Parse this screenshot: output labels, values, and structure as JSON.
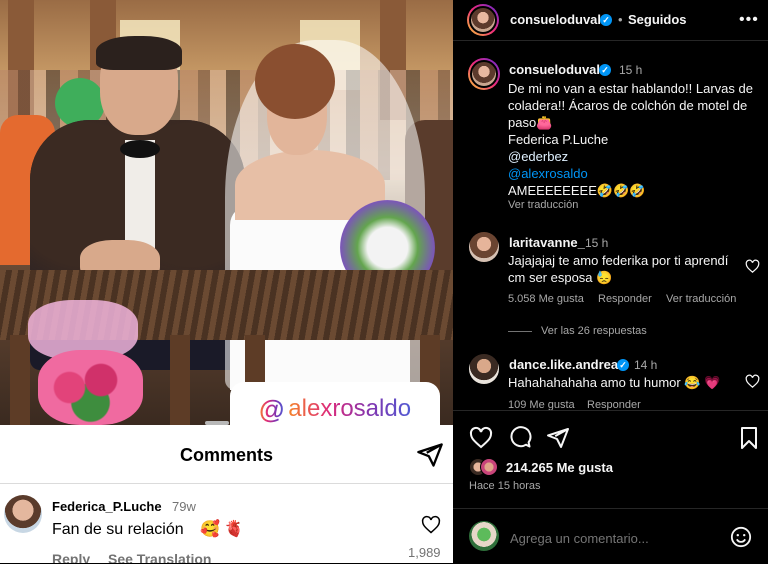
{
  "image_overlay": {
    "threads_handle": "alexrosaldo",
    "comments_panel": {
      "title": "Comments",
      "comment": {
        "user": "Federica_P.Luche",
        "time": "79w",
        "text": "Fan de su relación",
        "emoji": "🥰 🫀",
        "likes": "1,989",
        "reply_label": "Reply",
        "see_translation_label": "See Translation"
      }
    }
  },
  "header": {
    "username": "consueloduval",
    "dot": "•",
    "follow_status": "Seguidos",
    "more_label": "•••"
  },
  "caption": {
    "username": "consueloduval",
    "time": "15 h",
    "line1": "De mi no van a estar hablando!! Larvas de",
    "line2": "coladera!! Ácaros de colchón de motel de",
    "line3": "paso👛",
    "line4": "Federica P.Luche",
    "line5": "@ederbez",
    "line6": "@alexrosaldo",
    "line7": "AMEEEEEEEE🤣🤣🤣",
    "see_translation": "Ver traducción"
  },
  "comments": [
    {
      "username": "laritavanne_",
      "time": "15 h",
      "line1": "Jajajajaj te amo federika por ti aprendí",
      "line2": "cm ser esposa 😓",
      "likes": "5.058 Me gusta",
      "reply_label": "Responder",
      "see_translation": "Ver traducción",
      "view_replies": "Ver las 26 respuestas"
    },
    {
      "username": "dance.like.andrea",
      "time": "14 h",
      "text": "Hahahahahaha amo tu humor 😂 💗",
      "likes": "109 Me gusta",
      "reply_label": "Responder"
    }
  ],
  "actions": {
    "likes": "214.265 Me gusta",
    "posted": "Hace 15 horas"
  },
  "add_comment": {
    "placeholder": "Agrega un comentario..."
  },
  "colors": {
    "background": "#000000",
    "verified": "#0095f6",
    "mention": "#e0f1ff",
    "muted": "#a8a8a8"
  }
}
